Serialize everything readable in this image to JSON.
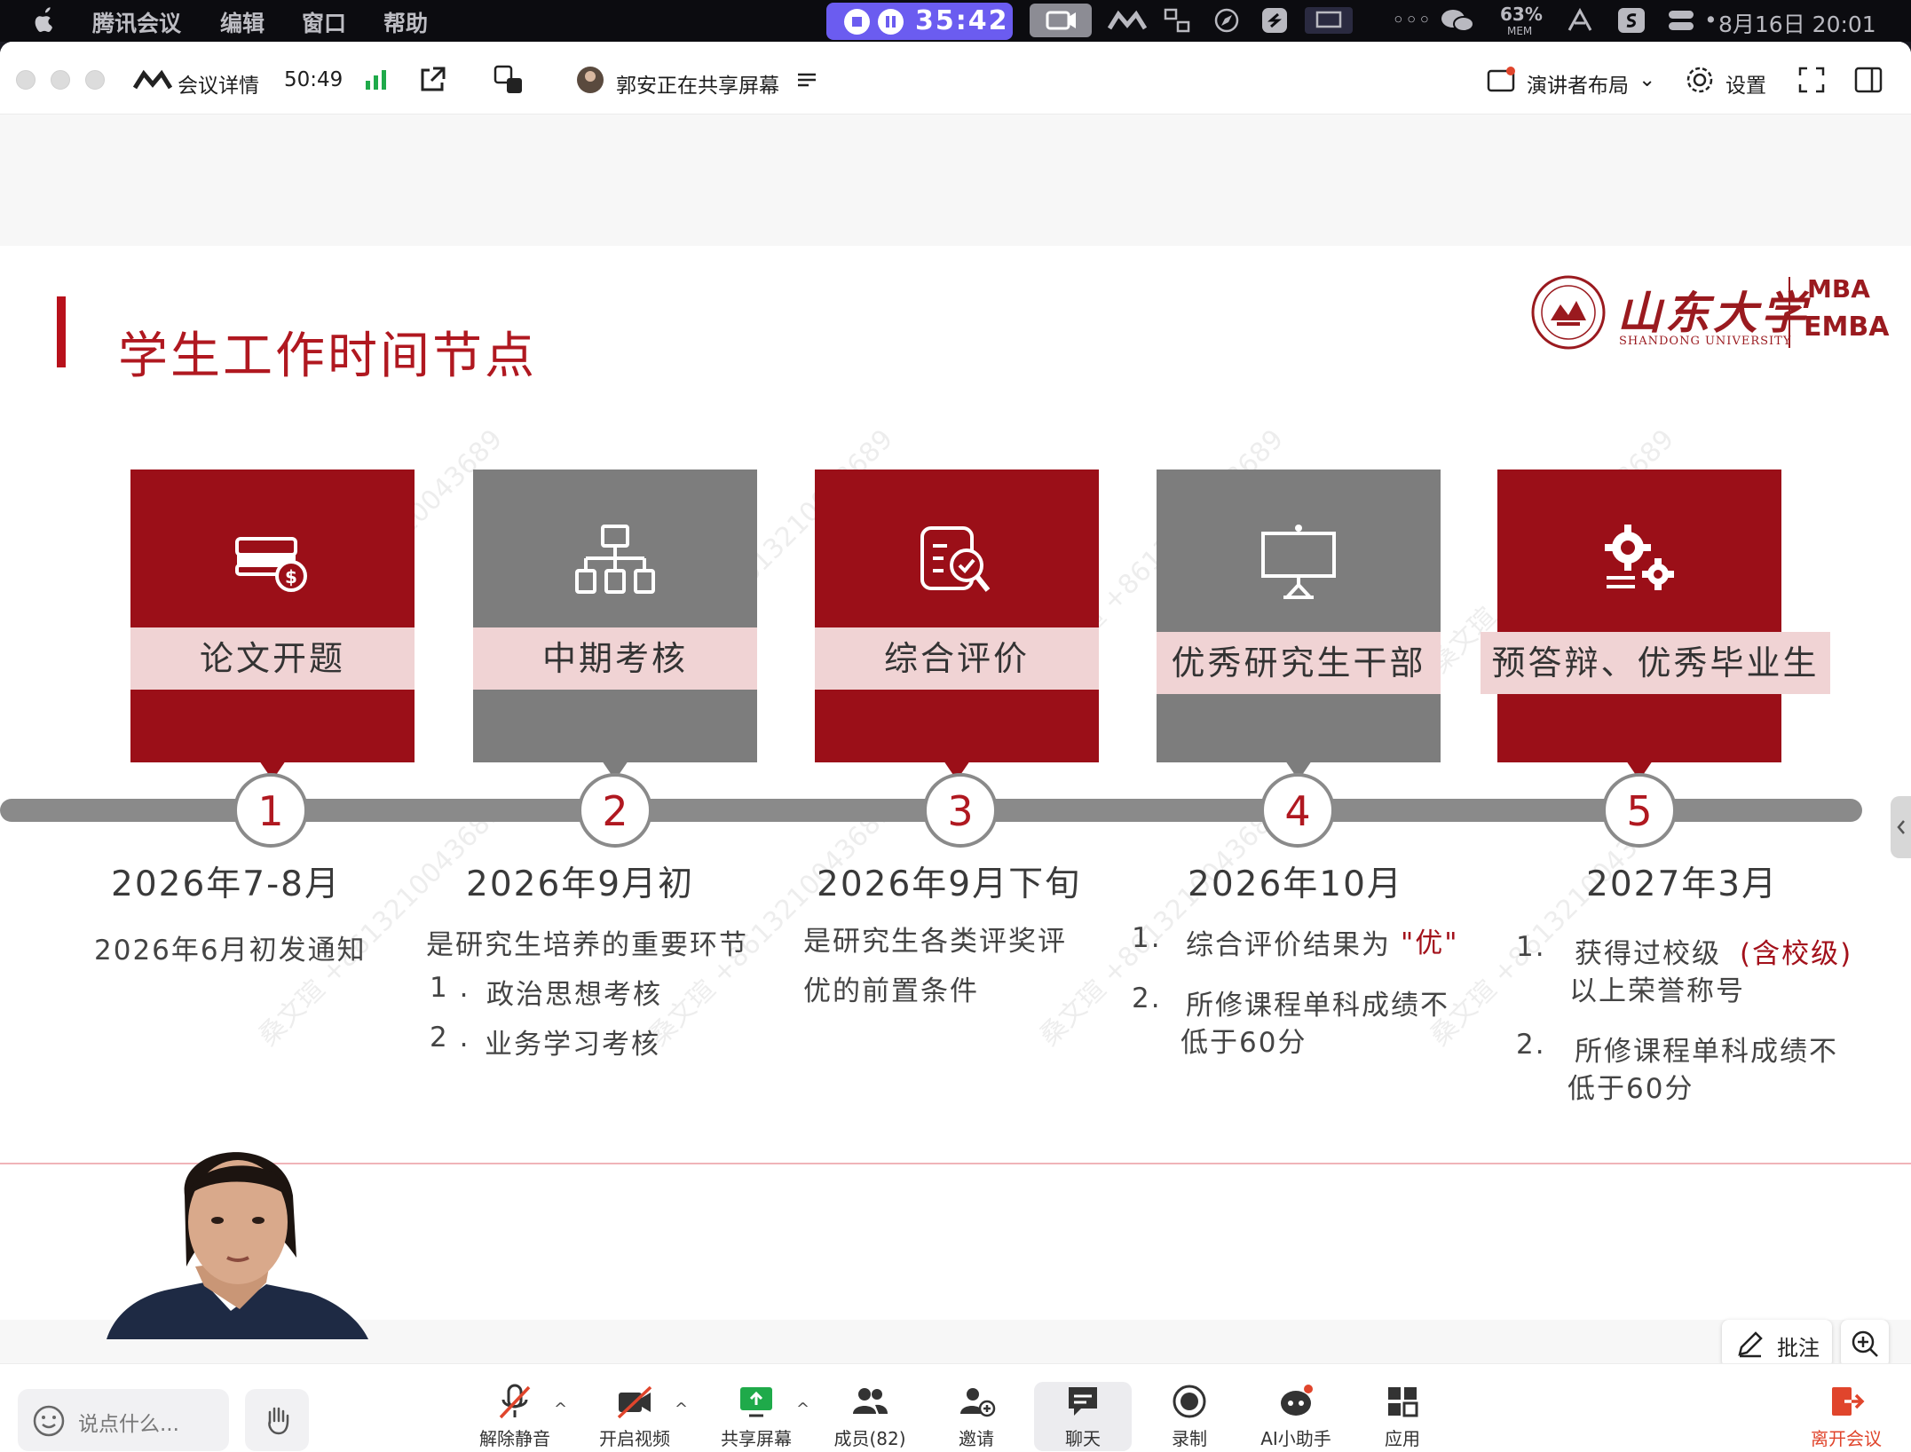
{
  "menubar": {
    "app_name": "腾讯会议",
    "menus": [
      "编辑",
      "窗口",
      "帮助"
    ],
    "record_timer": "35:42",
    "mem_percent": "63%",
    "mem_label": "MEM",
    "date_time": "8月16日  20:01"
  },
  "titlebar": {
    "meeting_details": "会议详情",
    "elapsed": "50:49",
    "sharing_status": "郭安正在共享屏幕",
    "layout_label": "演讲者布局",
    "settings_label": "设置"
  },
  "slide": {
    "title": "学生工作时间节点",
    "logo": {
      "cn": "山东大学",
      "en": "SHANDONG UNIVERSITY",
      "mba": "MBA",
      "emba": "EMBA"
    },
    "watermark": "桑文瑄 +8613210043689",
    "stages": [
      {
        "num": "1",
        "label": "论文开题",
        "icon": "payment-card-icon",
        "date": "2026年7-8月"
      },
      {
        "num": "2",
        "label": "中期考核",
        "icon": "hierarchy-icon",
        "date": "2026年9月初"
      },
      {
        "num": "3",
        "label": "综合评价",
        "icon": "document-search-icon",
        "date": "2026年9月下旬"
      },
      {
        "num": "4",
        "label": "优秀研究生干部",
        "icon": "presentation-board-icon",
        "date": "2026年10月"
      },
      {
        "num": "5",
        "label": "预答辩、优秀毕业生",
        "icon": "gears-icon",
        "date": "2027年3月"
      }
    ],
    "details": {
      "s1": {
        "line1": "2026年6月初发通知"
      },
      "s2": {
        "line1": "是研究生培养的重要环节",
        "item1_num": "1 .",
        "item1": "政治思想考核",
        "item2_num": "2 .",
        "item2": "业务学习考核"
      },
      "s3": {
        "line1": "是研究生各类评奖评",
        "line2": "优的前置条件"
      },
      "s4": {
        "item1_num": "1.",
        "item1_text": "综合评价结果为",
        "item1_hl": "\"优\"",
        "item2_num": "2.",
        "item2_line1": "所修课程单科成绩不",
        "item2_line2": "低于60分"
      },
      "s5": {
        "item1_num": "1.",
        "item1_text": "获得过校级",
        "item1_hl": "(含校级)",
        "item1_line2": "以上荣誉称号",
        "item2_num": "2.",
        "item2_line1": "所修课程单科成绩不",
        "item2_line2": "低于60分"
      }
    }
  },
  "overlay": {
    "annotate_label": "批注"
  },
  "toolbar": {
    "chat_placeholder": "说点什么...",
    "unmute": "解除静音",
    "start_video": "开启视频",
    "share_screen": "共享屏幕",
    "members": "成员(82)",
    "invite": "邀请",
    "chat": "聊天",
    "record": "录制",
    "ai_assistant": "AI小助手",
    "apps": "应用",
    "leave": "离开会议"
  },
  "colors": {
    "brand_red": "#9b0f18",
    "title_red": "#b01820",
    "card_gray": "#7d7d7d",
    "band_pink": "#f0d3d4",
    "rec_purple": "#6b5cf0",
    "leave_orange": "#e0452c"
  }
}
